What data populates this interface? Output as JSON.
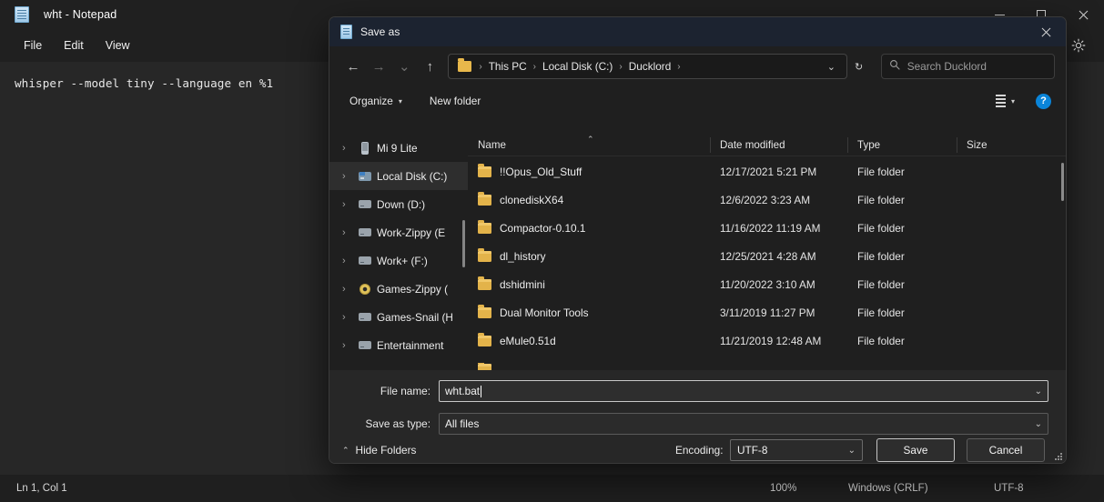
{
  "notepad": {
    "title": "wht - Notepad",
    "icon": "notepad-document-icon",
    "menus": [
      "File",
      "Edit",
      "View"
    ],
    "text": "whisper --model tiny --language en %1",
    "window_controls": {
      "minimize": "minimize-icon",
      "maximize": "maximize-icon",
      "close": "close-icon"
    },
    "settings_icon": "gear-icon",
    "status": {
      "ln_col": "Ln 1, Col 1",
      "zoom": "100%",
      "line_ending": "Windows (CRLF)",
      "encoding": "UTF-8"
    }
  },
  "dialog": {
    "title": "Save as",
    "icon": "notepad-document-icon",
    "close_label": "✕",
    "nav": {
      "back": "←",
      "forward": "→",
      "recent": "⌄",
      "up": "↑"
    },
    "address": {
      "folder_icon": "folder-icon",
      "crumbs": [
        "This PC",
        "Local Disk (C:)",
        "Ducklord"
      ],
      "separator": "›",
      "dropdown": "⌄",
      "refresh": "↻"
    },
    "search": {
      "icon": "search-icon",
      "placeholder": "Search Ducklord",
      "value": ""
    },
    "commands": {
      "organize": "Organize",
      "organize_caret": "▾",
      "new_folder": "New folder",
      "view_caret": "▾",
      "help": "?"
    },
    "tree": [
      {
        "label": "Mi 9 Lite",
        "icon": "phone-icon",
        "expander": "›",
        "selected": false
      },
      {
        "label": "Local Disk (C:)",
        "icon": "system-drive-icon",
        "expander": "›",
        "selected": true
      },
      {
        "label": "Down (D:)",
        "icon": "drive-icon",
        "expander": "›",
        "selected": false
      },
      {
        "label": "Work-Zippy (E",
        "icon": "drive-icon",
        "expander": "›",
        "selected": false
      },
      {
        "label": "Work+ (F:)",
        "icon": "drive-icon",
        "expander": "›",
        "selected": false
      },
      {
        "label": "Games-Zippy (",
        "icon": "optical-drive-icon",
        "expander": "›",
        "selected": false
      },
      {
        "label": "Games-Snail (H",
        "icon": "drive-icon",
        "expander": "›",
        "selected": false
      },
      {
        "label": "Entertainment",
        "icon": "drive-icon",
        "expander": "›",
        "selected": false
      }
    ],
    "columns": {
      "name": "Name",
      "date_modified": "Date modified",
      "type": "Type",
      "size": "Size",
      "sort_indicator": "⌃"
    },
    "files": [
      {
        "name": "!!Opus_Old_Stuff",
        "date": "12/17/2021 5:21 PM",
        "type": "File folder",
        "size": ""
      },
      {
        "name": "clonediskX64",
        "date": "12/6/2022 3:23 AM",
        "type": "File folder",
        "size": ""
      },
      {
        "name": "Compactor-0.10.1",
        "date": "11/16/2022 11:19 AM",
        "type": "File folder",
        "size": ""
      },
      {
        "name": "dl_history",
        "date": "12/25/2021 4:28 AM",
        "type": "File folder",
        "size": ""
      },
      {
        "name": "dshidmini",
        "date": "11/20/2022 3:10 AM",
        "type": "File folder",
        "size": ""
      },
      {
        "name": "Dual Monitor Tools",
        "date": "3/11/2019 11:27 PM",
        "type": "File folder",
        "size": ""
      },
      {
        "name": "eMule0.51d",
        "date": "11/21/2019 12:48 AM",
        "type": "File folder",
        "size": ""
      }
    ],
    "form": {
      "file_name_label": "File name:",
      "file_name_value": "wht.bat",
      "save_as_type_label": "Save as type:",
      "save_as_type_value": "All files",
      "combo_arrow": "⌄"
    },
    "actions": {
      "hide_folders": "Hide Folders",
      "hide_folders_caret": "⌃",
      "encoding_label": "Encoding:",
      "encoding_value": "UTF-8",
      "save": "Save",
      "cancel": "Cancel"
    }
  },
  "colors": {
    "notepad_bg": "#202020",
    "editor_bg": "#272727",
    "dialog_bg": "#1f1f1f",
    "dialog_titlebar": "#1c2330",
    "folder_yellow": "#e3b34a",
    "help_blue": "#0a84d8",
    "selection": "#2e2e2e"
  }
}
